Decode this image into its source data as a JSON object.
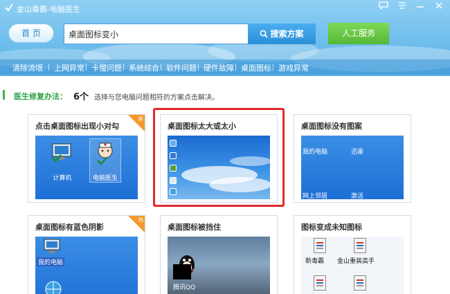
{
  "app": {
    "title": "金山毒霸-电脑医生",
    "home_label": "首 页",
    "search_value": "桌面图标变小",
    "search_button": "搜索方案",
    "service_button": "人工服务"
  },
  "categories": [
    "清除流氓",
    "上网异常",
    "卡慢问题",
    "系统综合",
    "软件问题",
    "硬件故障",
    "桌面图标",
    "游戏异常"
  ],
  "info": {
    "label": "医生修复办法：",
    "count": "6个",
    "hint": "选择与您电脑问题相符的方案点击解决。"
  },
  "cards": [
    {
      "title": "点击桌面图标出现小对勾",
      "badge": "新",
      "icons": [
        "计算机",
        "电脑医生"
      ]
    },
    {
      "title": "桌面图标太大或太小"
    },
    {
      "title": "桌面图标没有图案",
      "icons": [
        "我的电脑",
        "迅雷",
        "网上邻居",
        "激活"
      ]
    },
    {
      "title": "桌面图标有蓝色阴影",
      "badge": "热",
      "icons": [
        "我的电脑"
      ]
    },
    {
      "title": "桌面图标被挡住",
      "icons": [
        "腾讯QQ"
      ]
    },
    {
      "title": "图标变成未知图标",
      "icons": [
        "新毒霸",
        "金山重装高手"
      ]
    }
  ],
  "colors": {
    "header_top": "#8fd0f3",
    "header_bottom": "#5bb0e6",
    "search_button": "#2d8fd8",
    "service_button": "#55b836",
    "info_green": "#2ea347",
    "highlight_red": "#e1292a",
    "badge_orange": "#f39a2d"
  }
}
